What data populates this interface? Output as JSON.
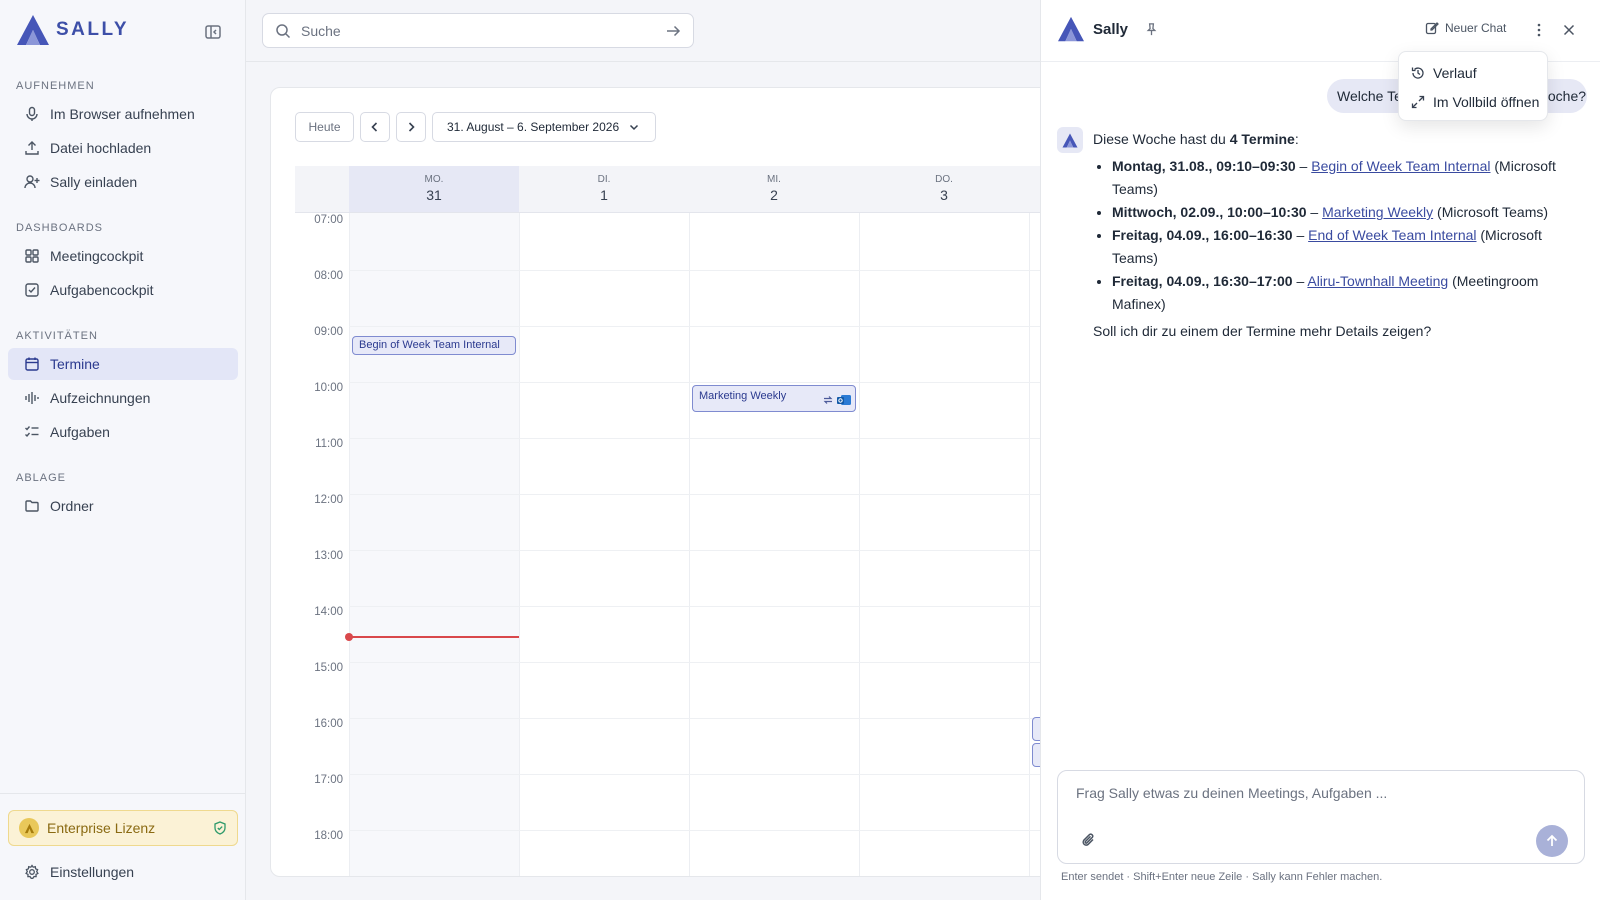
{
  "app": {
    "brand": "SALLY"
  },
  "sidebar": {
    "sections": [
      {
        "title": "AUFNEHMEN",
        "items": [
          {
            "label": "Im Browser aufnehmen",
            "icon": "mic-icon"
          },
          {
            "label": "Datei hochladen",
            "icon": "upload-icon"
          },
          {
            "label": "Sally einladen",
            "icon": "user-plus-icon"
          }
        ]
      },
      {
        "title": "DASHBOARDS",
        "items": [
          {
            "label": "Meetingcockpit",
            "icon": "grid-icon"
          },
          {
            "label": "Aufgabencockpit",
            "icon": "checkbox-icon"
          }
        ]
      },
      {
        "title": "AKTIVITÄTEN",
        "items": [
          {
            "label": "Termine",
            "icon": "calendar-icon",
            "active": true
          },
          {
            "label": "Aufzeichnungen",
            "icon": "waveform-icon"
          },
          {
            "label": "Aufgaben",
            "icon": "tasklist-icon"
          }
        ]
      },
      {
        "title": "ABLAGE",
        "items": [
          {
            "label": "Ordner",
            "icon": "folder-icon"
          }
        ]
      }
    ],
    "license_label": "Enterprise Lizenz",
    "settings_label": "Einstellungen"
  },
  "topbar": {
    "search_placeholder": "Suche"
  },
  "calendar": {
    "today_label": "Heute",
    "range_label": "31. August – 6. September 2026",
    "days": [
      {
        "name": "MO.",
        "num": "31",
        "today": true
      },
      {
        "name": "DI.",
        "num": "1"
      },
      {
        "name": "MI.",
        "num": "2"
      },
      {
        "name": "DO.",
        "num": "3"
      }
    ],
    "hours": [
      "07:00",
      "08:00",
      "09:00",
      "10:00",
      "11:00",
      "12:00",
      "13:00",
      "14:00",
      "15:00",
      "16:00",
      "17:00",
      "18:00"
    ],
    "events": [
      {
        "title": "Begin of Week Team Internal"
      },
      {
        "title": "Marketing Weekly"
      }
    ]
  },
  "chat": {
    "title": "Sally",
    "new_chat_label": "Neuer Chat",
    "menu": {
      "history_label": "Verlauf",
      "fullscreen_label": "Im Vollbild öffnen"
    },
    "user_message": "Welche Termine habe ich diese Woche?",
    "bot": {
      "intro_prefix": "Diese Woche hast du ",
      "intro_bold": "4 Termine",
      "intro_suffix": ":",
      "items": [
        {
          "when": "Montag, 31.08., 09:10–09:30",
          "sep": " – ",
          "title": "Begin of Week Team Internal",
          "where": " (Microsoft Teams)"
        },
        {
          "when": "Mittwoch, 02.09., 10:00–10:30",
          "sep": " – ",
          "title": "Marketing Weekly",
          "where": " (Microsoft Teams)"
        },
        {
          "when": "Freitag, 04.09., 16:00–16:30",
          "sep": " – ",
          "title": "End of Week Team Internal",
          "where": " (Microsoft Teams)"
        },
        {
          "when": "Freitag, 04.09., 16:30–17:00",
          "sep": " – ",
          "title": "Aliru-Townhall Meeting",
          "where": " (Meetingroom Mafinex)"
        }
      ],
      "follow_up": "Soll ich dir zu einem der Termine mehr Details zeigen?"
    },
    "input_placeholder": "Frag Sally etwas zu deinen Meetings, Aufgaben ...",
    "hint": "Enter sendet · Shift+Enter neue Zeile · Sally kann Fehler machen."
  },
  "colors": {
    "accent": "#3d4fa8",
    "active_bg": "#e3e6f7",
    "now_line": "#d9484b",
    "license_bg": "#fbf2d6"
  }
}
